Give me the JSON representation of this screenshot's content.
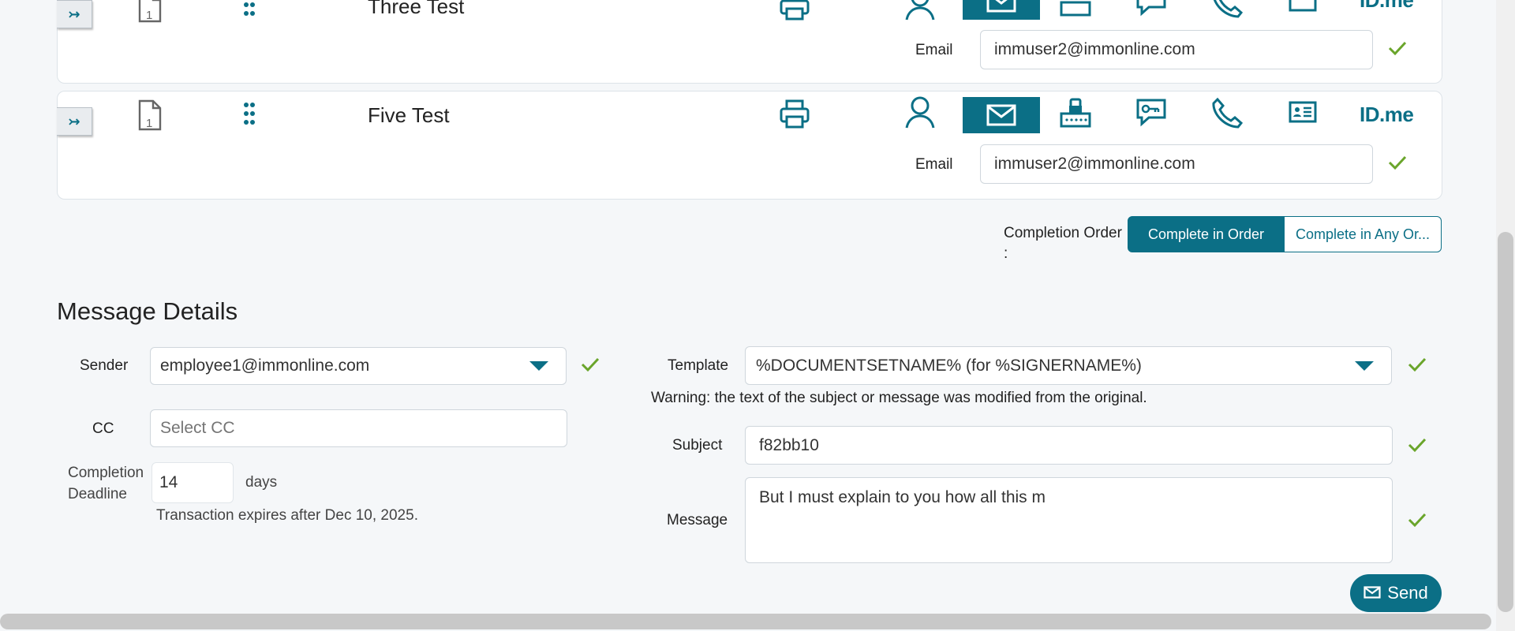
{
  "signers": [
    {
      "name": "Three Test",
      "email_label": "Email",
      "email_value": "immuser2@immonline.com",
      "order": "1"
    },
    {
      "name": "Five Test",
      "email_label": "Email",
      "email_value": "immuser2@immonline.com",
      "order": "1"
    }
  ],
  "auth_methods": [
    "print-icon",
    "person-icon",
    "email-icon",
    "sms-code-icon",
    "chat-key-icon",
    "phone-icon",
    "id-card-icon",
    "idme-logo"
  ],
  "idme_label": "ID.me",
  "completion_order": {
    "label": "Completion Order",
    "colon": ":",
    "options": [
      "Complete in Order",
      "Complete in Any Or..."
    ],
    "selected": "Complete in Order"
  },
  "message_details": {
    "title": "Message Details",
    "sender_label": "Sender",
    "sender_value": "employee1@immonline.com",
    "cc_label": "CC",
    "cc_placeholder": "Select CC",
    "deadline_label_line1": "Completion",
    "deadline_label_line2": "Deadline",
    "deadline_value": "14",
    "deadline_unit": "days",
    "expiry_note": "Transaction expires after Dec 10, 2025.",
    "template_label": "Template",
    "template_value": "%DOCUMENTSETNAME% (for %SIGNERNAME%)",
    "warning": "Warning: the text of the subject or message was modified from the original.",
    "subject_label": "Subject",
    "subject_value": "f82bb10",
    "message_label": "Message",
    "message_value": "But I must explain to you how all this m"
  },
  "send_label": "Send",
  "colors": {
    "accent": "#0b6f86",
    "check": "#6aa52b",
    "background": "#f5f7f9"
  }
}
